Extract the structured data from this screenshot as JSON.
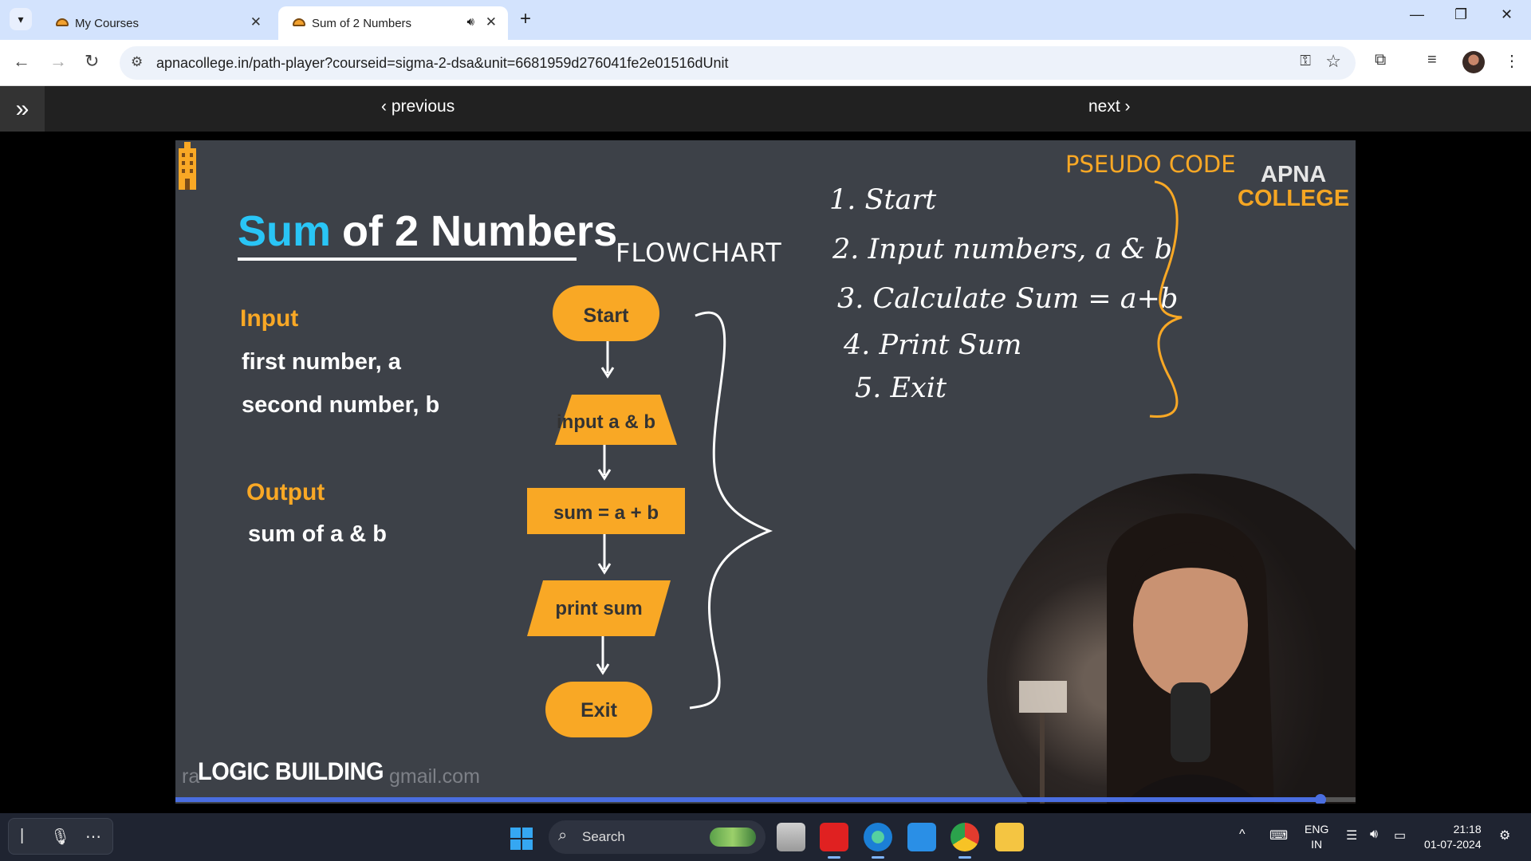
{
  "browser": {
    "tabs": [
      {
        "title": "My Courses",
        "active": false
      },
      {
        "title": "Sum of 2 Numbers",
        "active": true
      }
    ],
    "url": "apnacollege.in/path-player?courseid=sigma-2-dsa&unit=6681959d276041fe2e01516dUnit"
  },
  "player": {
    "previous_label": "previous",
    "next_label": "next",
    "progress": 0.97
  },
  "slide": {
    "title_accent": "Sum",
    "title_rest": "of 2 Numbers",
    "input_heading": "Input",
    "input_lines": [
      "first number, a",
      "second number, b"
    ],
    "output_heading": "Output",
    "output_lines": [
      "sum of a & b"
    ],
    "flowchart_label": "FLOWCHART",
    "flowchart_steps": [
      "Start",
      "input a & b",
      "sum = a + b",
      "print sum",
      "Exit"
    ],
    "pseudo_label": "PSEUDO CODE",
    "pseudo_steps": [
      "1. Start",
      "2. Input numbers, a & b",
      "3. Calculate Sum = a+b",
      "4. Print Sum",
      "5. Exit"
    ],
    "brand_top": "APNA",
    "brand_bottom": "COLLEGE",
    "footer_label": "LOGIC BUILDING",
    "watermark_left": "ra",
    "watermark_right": "gmail.com"
  },
  "colors": {
    "accent_blue": "#29c5f6",
    "accent_orange": "#f9a825",
    "slide_bg": "#3d4148"
  },
  "taskbar": {
    "search_label": "Search",
    "lang_top": "ENG",
    "lang_bottom": "IN",
    "time": "21:18",
    "date": "01-07-2024",
    "apps": [
      "file-explorer-icon",
      "youtube-icon",
      "edge-icon",
      "vscode-icon",
      "chrome-icon",
      "folder-icon"
    ]
  }
}
